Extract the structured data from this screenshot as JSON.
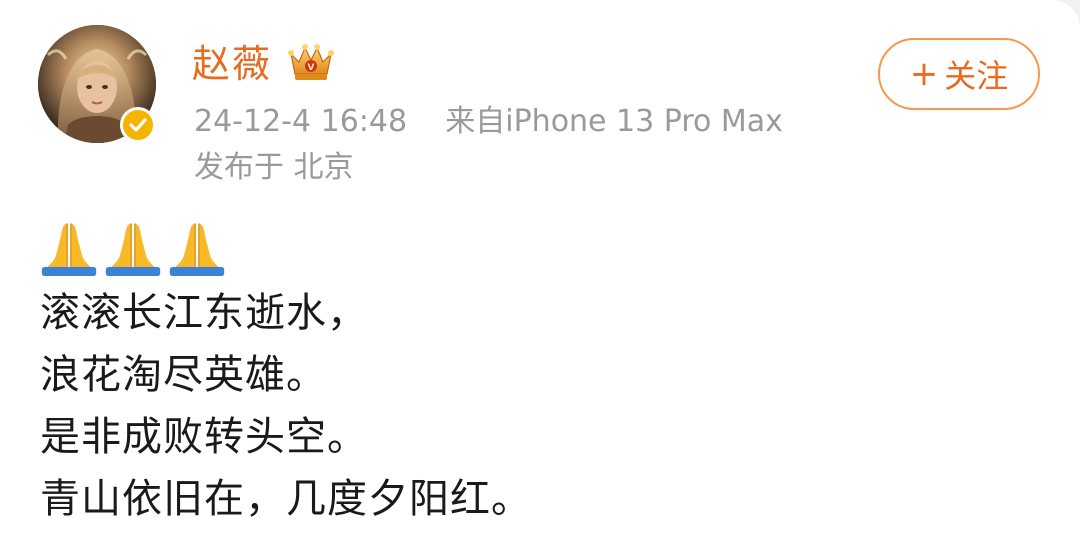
{
  "post": {
    "author": {
      "name": "赵薇",
      "avatar_icon": "user-avatar",
      "verified_icon": "verified-check-icon",
      "vip_icon": "vip-crown-icon"
    },
    "meta": {
      "timestamp": "24-12-4 16:48",
      "source": "来自iPhone 13 Pro Max",
      "location": "发布于 北京"
    },
    "follow_button": {
      "icon": "plus",
      "label": "关注"
    },
    "emoji_count": 3,
    "emoji_name": "folded-hands-emoji",
    "lines": [
      "滚滚长江东逝水，",
      "浪花淘尽英雄。",
      "是非成败转头空。",
      "青山依旧在，几度夕阳红。"
    ]
  },
  "colors": {
    "accent": "#ea6a1e",
    "follow_border": "#f59a4a",
    "meta_text": "#9a9a9a",
    "body_text": "#1a1a1a",
    "verified": "#f5b400"
  }
}
